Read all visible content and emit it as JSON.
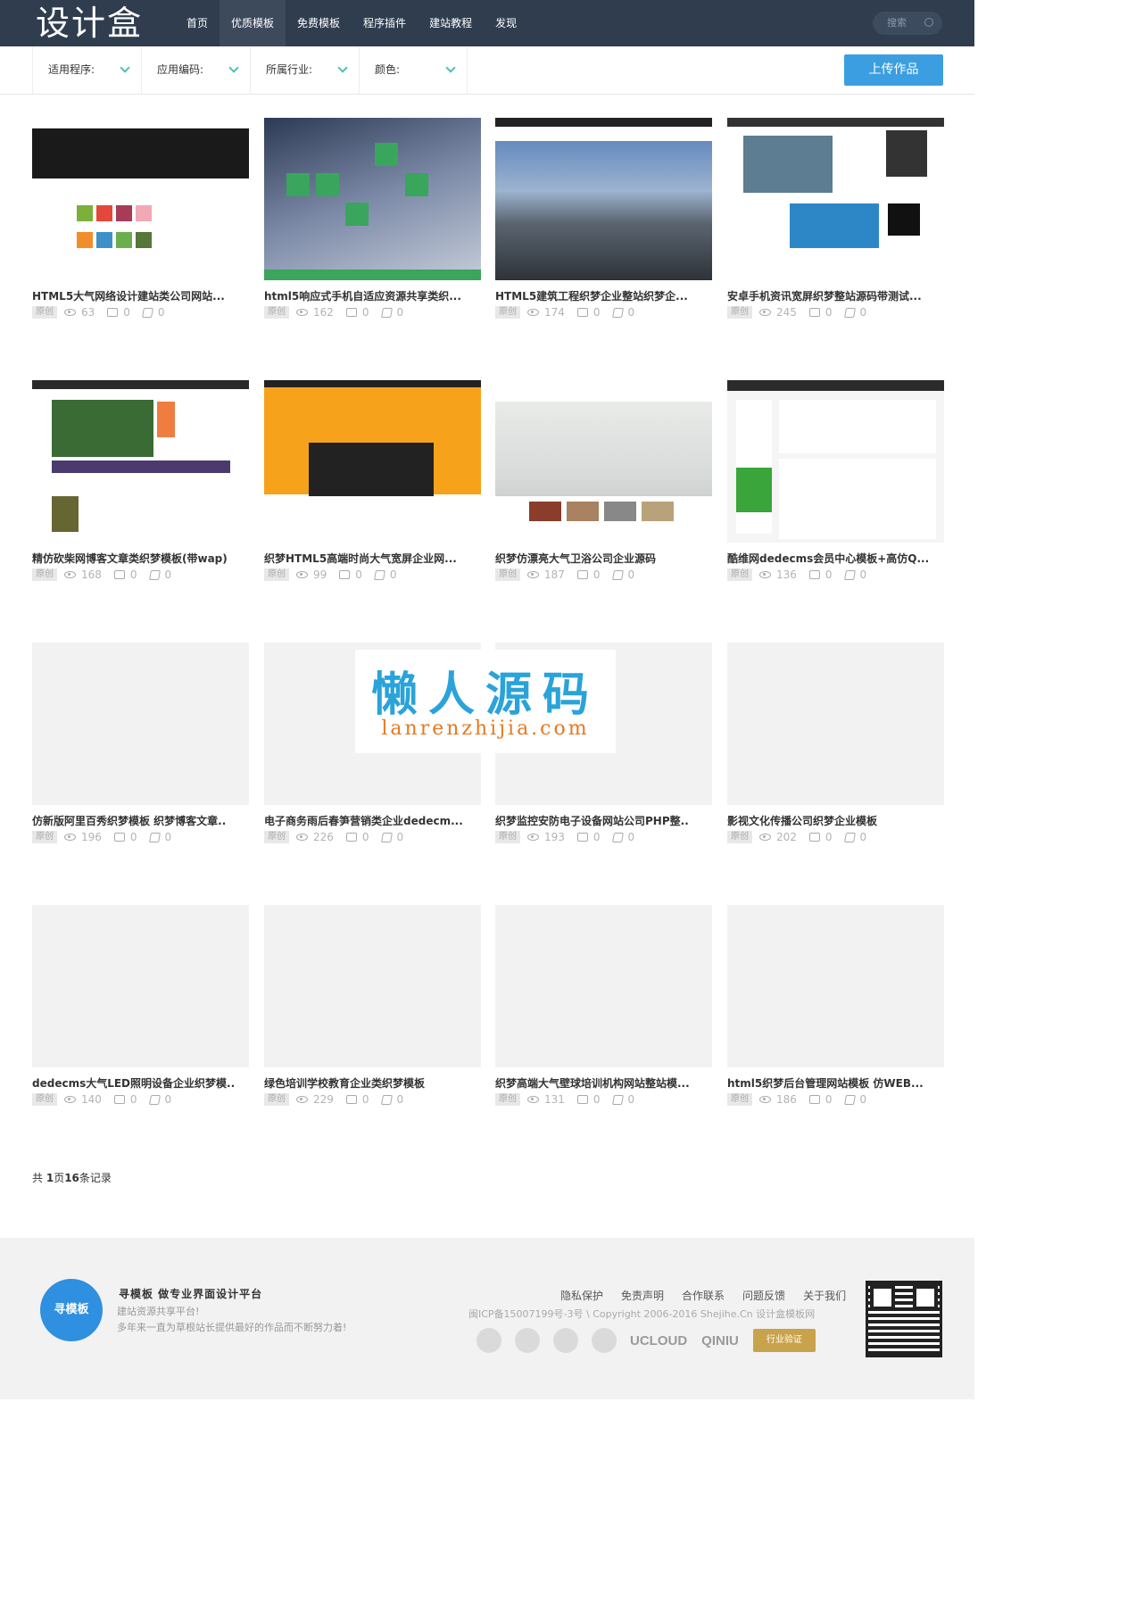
{
  "header": {
    "logo": "设计盒",
    "nav": [
      "首页",
      "优质模板",
      "免费模板",
      "程序插件",
      "建站教程",
      "发现"
    ],
    "active_nav": "优质模板",
    "search_placeholder": "搜索"
  },
  "filters": {
    "items": [
      "适用程序:",
      "应用编码:",
      "所属行业:",
      "颜色:"
    ],
    "upload_label": "上传作品"
  },
  "cards": [
    {
      "title": "HTML5大气网络设计建站类公司网站...",
      "tag": "原创",
      "views": "63",
      "comments": "0",
      "shares": "0"
    },
    {
      "title": "html5响应式手机自适应资源共享类织...",
      "tag": "原创",
      "views": "162",
      "comments": "0",
      "shares": "0"
    },
    {
      "title": "HTML5建筑工程织梦企业整站织梦企...",
      "tag": "原创",
      "views": "174",
      "comments": "0",
      "shares": "0"
    },
    {
      "title": "安卓手机资讯宽屏织梦整站源码带测试...",
      "tag": "原创",
      "views": "245",
      "comments": "0",
      "shares": "0"
    },
    {
      "title": "精仿砍柴网博客文章类织梦模板(带wap)",
      "tag": "原创",
      "views": "168",
      "comments": "0",
      "shares": "0"
    },
    {
      "title": "织梦HTML5高端时尚大气宽屏企业网...",
      "tag": "原创",
      "views": "99",
      "comments": "0",
      "shares": "0"
    },
    {
      "title": "织梦仿漂亮大气卫浴公司企业源码",
      "tag": "原创",
      "views": "187",
      "comments": "0",
      "shares": "0"
    },
    {
      "title": "酷维网dedecms会员中心模板+高仿Q...",
      "tag": "原创",
      "views": "136",
      "comments": "0",
      "shares": "0"
    },
    {
      "title": "仿新版阿里百秀织梦模板 织梦博客文章..",
      "tag": "原创",
      "views": "196",
      "comments": "0",
      "shares": "0"
    },
    {
      "title": "电子商务雨后春笋营销类企业dedecm...",
      "tag": "原创",
      "views": "226",
      "comments": "0",
      "shares": "0"
    },
    {
      "title": "织梦监控安防电子设备网站公司PHP整..",
      "tag": "原创",
      "views": "193",
      "comments": "0",
      "shares": "0"
    },
    {
      "title": "影视文化传播公司织梦企业模板",
      "tag": "原创",
      "views": "202",
      "comments": "0",
      "shares": "0"
    },
    {
      "title": "dedecms大气LED照明设备企业织梦模..",
      "tag": "原创",
      "views": "140",
      "comments": "0",
      "shares": "0"
    },
    {
      "title": "绿色培训学校教育企业类织梦模板",
      "tag": "原创",
      "views": "229",
      "comments": "0",
      "shares": "0"
    },
    {
      "title": "织梦高端大气壁球培训机构网站整站模...",
      "tag": "原创",
      "views": "131",
      "comments": "0",
      "shares": "0"
    },
    {
      "title": "html5织梦后台管理网站模板 仿WEB...",
      "tag": "原创",
      "views": "186",
      "comments": "0",
      "shares": "0"
    }
  ],
  "watermark": {
    "cn": "懒人源码",
    "en": "lanrenzhijia.com"
  },
  "pagination": {
    "prefix": "共 ",
    "pages": "1",
    "mid": "页",
    "count": "16",
    "suffix": "条记录"
  },
  "footer": {
    "logo": "寻模板",
    "slogan": "寻模板  做专业界面设计平台",
    "sub1": "建站资源共享平台!",
    "sub2": "多年来一直为草根站长提供最好的作品而不断努力着!",
    "links": [
      "隐私保护",
      "免责声明",
      "合作联系",
      "问题反馈",
      "关于我们"
    ],
    "copyright": "闽ICP备15007199号-3号 \\ Copyright 2006-2016 Shejihe.Cn 设计盒模板网",
    "brands": [
      "UCLOUD",
      "QINIU"
    ],
    "badge": "行业验证"
  }
}
